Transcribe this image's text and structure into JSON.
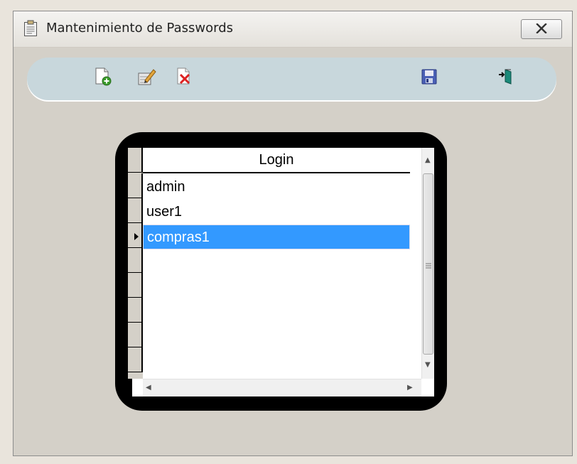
{
  "window": {
    "title": "Mantenimiento de Passwords",
    "title_icon": "clipboard-icon",
    "close_icon": "close-icon"
  },
  "toolbar": {
    "buttons": [
      {
        "name": "new-record",
        "icon": "new-document-icon"
      },
      {
        "name": "edit-record",
        "icon": "edit-icon"
      },
      {
        "name": "delete-record",
        "icon": "delete-icon"
      },
      {
        "name": "save-record",
        "icon": "save-disk-icon"
      },
      {
        "name": "exit",
        "icon": "exit-door-icon"
      }
    ]
  },
  "grid": {
    "column_header": "Login",
    "rows": [
      "admin",
      "user1",
      "compras1"
    ],
    "selected_row": 2,
    "selection_color": "#3399ff"
  }
}
